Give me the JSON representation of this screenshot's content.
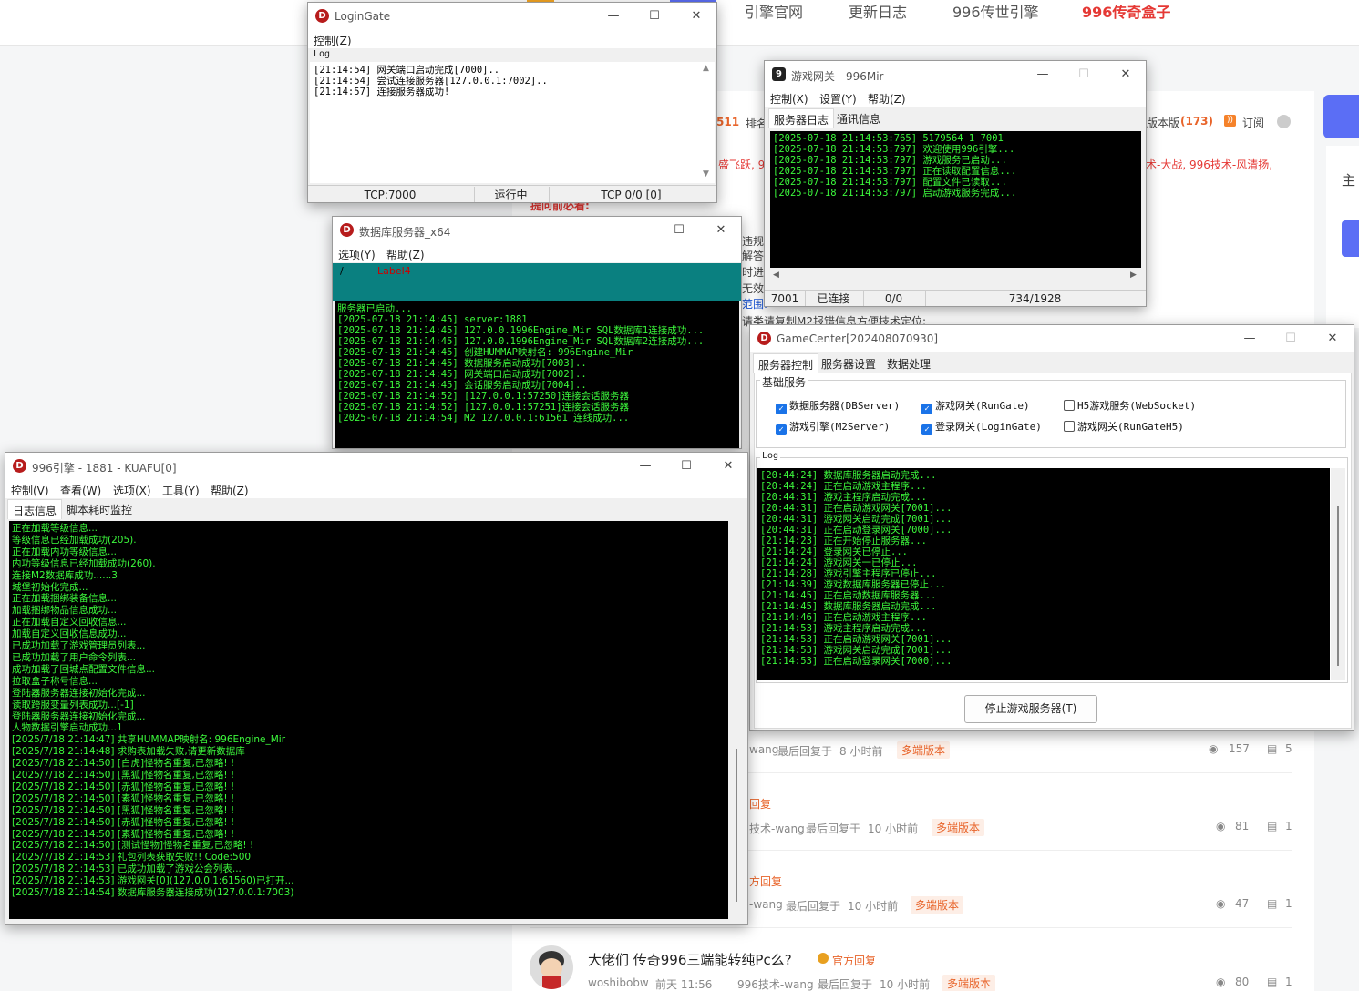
{
  "bg": {
    "nav": [
      "引擎官网",
      "更新日志",
      "996传世引擎",
      "996传奇盒子"
    ],
    "snippets": {
      "count_511": "511",
      "rank": "排名",
      "sort_version": "版本版",
      "sort_count": "(173)",
      "subscribe": "订阅",
      "tech_line": "术-大战, 996技术-风清扬,",
      "fly": "盛飞跃, 9",
      "must_read": "提问前必看:",
      "rule1": "违规",
      "rule2": "解答",
      "rule3": "时进",
      "rule4": "无效",
      "rule5": "范围:",
      "copy_hint": "请类请复制M2报错信息方便技术定位;",
      "side_title": "主"
    },
    "posts": [
      {
        "title": "",
        "badge": "",
        "user": "wang",
        "reply": "最后回复于",
        "time": "8 小时前",
        "tag": "多端版本",
        "views": "157",
        "comments": "5"
      },
      {
        "title": "",
        "badge": "回复",
        "user": "技术-wang",
        "reply": "最后回复于",
        "time": "10 小时前",
        "tag": "多端版本",
        "views": "81",
        "comments": "1"
      },
      {
        "title": "",
        "badge": "方回复",
        "user": "-wang",
        "reply": "最后回复于",
        "time": "10 小时前",
        "tag": "多端版本",
        "views": "47",
        "comments": "1"
      },
      {
        "title": "大佬们 传奇996三端能转纯Pc么?",
        "badge": "官方回复",
        "author": "woshibobw",
        "date": "前天 11:56",
        "user": "996技术-wang",
        "reply": "最后回复于",
        "time": "10 小时前",
        "tag": "多端版本",
        "views": "80",
        "comments": "1"
      }
    ]
  },
  "login_gate": {
    "title": "LoginGate",
    "menu": [
      "控制(Z)"
    ],
    "log_label": "Log",
    "log": "[21:14:54] 网关端口启动完成[7000]..\n[21:14:54] 尝试连接服务器[127.0.0.1:7002]..\n[21:14:57] 连接服务器成功!",
    "status": [
      "TCP:7000",
      "运行中",
      "TCP 0/0 [0]"
    ]
  },
  "db_server": {
    "title": "数据库服务器_x64",
    "menu": [
      "选项(Y)",
      "帮助(Z)"
    ],
    "panel_slash": "/",
    "panel_label": "Label4",
    "log": "服务器已启动...\n[2025-07-18 21:14:45] server:1881\n[2025-07-18 21:14:45] 127.0.0.1996Engine_Mir SQL数据库1连接成功...\n[2025-07-18 21:14:45] 127.0.0.1996Engine_Mir SQL数据库2连接成功...\n[2025-07-18 21:14:45] 创建HUMMAP映射名: 996Engine_Mir\n[2025-07-18 21:14:45] 数据服务启动成功[7003]..\n[2025-07-18 21:14:45] 网关端口启动成功[7002]..\n[2025-07-18 21:14:45] 会话服务启动成功[7004]..\n[2025-07-18 21:14:52] [127.0.0.1:57250]连接会话服务器\n[2025-07-18 21:14:52] [127.0.0.1:57251]连接会话服务器\n[2025-07-18 21:14:54] M2 127.0.0.1:61561 连线成功..."
  },
  "game_gate": {
    "title": "游戏网关 - 996Mir",
    "menu": [
      "控制(X)",
      "设置(Y)",
      "帮助(Z)"
    ],
    "tabs": [
      "服务器日志",
      "通讯信息"
    ],
    "log": "[2025-07-18 21:14:53:765] 5179564 1 7001\n[2025-07-18 21:14:53:797] 欢迎使用996引擎...\n[2025-07-18 21:14:53:797] 游戏服务已启动...\n[2025-07-18 21:14:53:797] 正在读取配置信息...\n[2025-07-18 21:14:53:797] 配置文件已读取...\n[2025-07-18 21:14:53:797] 启动游戏服务完成...",
    "status": [
      "7001",
      "已连接",
      "0/0",
      "734/1928"
    ]
  },
  "game_center": {
    "title": "GameCenter[202408070930]",
    "tabs": [
      "服务器控制",
      "服务器设置",
      "数据处理"
    ],
    "group_label": "基础服务",
    "checks": [
      {
        "label": "数据服务器(DBServer)",
        "checked": true
      },
      {
        "label": "游戏网关(RunGate)",
        "checked": true
      },
      {
        "label": "H5游戏服务(WebSocket)",
        "checked": false
      },
      {
        "label": "游戏引擎(M2Server)",
        "checked": true
      },
      {
        "label": "登录网关(LoginGate)",
        "checked": true
      },
      {
        "label": "游戏网关(RunGateH5)",
        "checked": false
      }
    ],
    "log_label": "Log",
    "log": "[20:44:24] 数据库服务器启动完成...\n[20:44:24] 正在启动游戏主程序...\n[20:44:31] 游戏主程序启动完成...\n[20:44:31] 正在启动游戏网关[7001]...\n[20:44:31] 游戏网关启动完成[7001]...\n[20:44:31] 正在启动登录网关[7000]...\n[21:14:23] 正在开始停止服务器...\n[21:14:24] 登录网关已停止...\n[21:14:24] 游戏网关一已停止...\n[21:14:28] 游戏引擎主程序已停止...\n[21:14:39] 游戏数据库服务器已停止...\n[21:14:45] 正在启动数据库服务器...\n[21:14:45] 数据库服务器启动完成...\n[21:14:46] 正在启动游戏主程序...\n[21:14:53] 游戏主程序启动完成...\n[21:14:53] 正在启动游戏网关[7001]...\n[21:14:53] 游戏网关启动完成[7001]...\n[21:14:53] 正在启动登录网关[7000]...",
    "button": "停止游戏服务器(T)"
  },
  "engine": {
    "title": "996引擎 - 1881 - KUAFU[0]",
    "menu": [
      "控制(V)",
      "查看(W)",
      "选项(X)",
      "工具(Y)",
      "帮助(Z)"
    ],
    "tabs": [
      "日志信息",
      "脚本耗时监控"
    ],
    "log": "正在加载等级信息...\n等级信息已经加载成功(205).\n正在加载内功等级信息...\n内功等级信息已经加载成功(260).\n连接M2数据库成功......3\n城堡初始化完成...\n正在加载捆绑装备信息...\n加载捆绑物品信息成功...\n正在加载自定义回收信息...\n加载自定义回收信息成功...\n已成功加载了游戏管理员列表...\n已成功加载了用户命令列表...\n成功加载了回城点配置文件信息...\n拉取盒子称号信息...\n登陆器服务器连接初始化完成...\n读取跨服变量列表成功...[-1]\n登陆器服务器连接初始化完成...\n人物数据引擎启动成功...1\n[2025/7/18 21:14:47] 共享HUMMAP映射名: 996Engine_Mir\n[2025/7/18 21:14:48] 求购表加载失败,请更新数据库\n[2025/7/18 21:14:50] [白虎]怪物名重复,已忽略! !\n[2025/7/18 21:14:50] [黑狐]怪物名重复,已忽略! !\n[2025/7/18 21:14:50] [赤狐]怪物名重复,已忽略! !\n[2025/7/18 21:14:50] [素狐]怪物名重复,已忽略! !\n[2025/7/18 21:14:50] [黑狐]怪物名重复,已忽略! !\n[2025/7/18 21:14:50] [赤狐]怪物名重复,已忽略! !\n[2025/7/18 21:14:50] [素狐]怪物名重复,已忽略! !\n[2025/7/18 21:14:50] [测试怪物]怪物名重复,已忽略! !\n[2025/7/18 21:14:53] 礼包列表获取失败!! Code:500\n[2025/7/18 21:14:53] 已成功加载了游戏公会列表...\n[2025/7/18 21:14:53] 游戏网关[0](127.0.0.1:61560)已打开...\n[2025/7/18 21:14:54] 数据库服务器连接成功(127.0.0.1:7003)"
  },
  "window_buttons": {
    "min": "—",
    "max": "☐",
    "close": "✕"
  },
  "colors": {
    "console_bg": "#000000",
    "console_text": "#3cf83c",
    "teal_panel": "#0a8080",
    "nav_hot": "#e53935",
    "tag": "#e8642a"
  }
}
